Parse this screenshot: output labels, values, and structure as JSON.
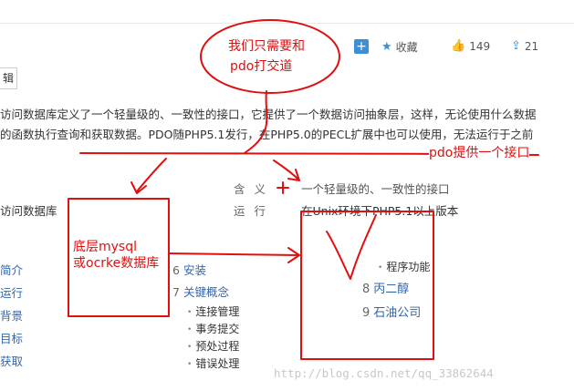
{
  "toolbar": {
    "plus_icon": "+",
    "collect_label": "收藏",
    "like_count": "149",
    "share_count": "21"
  },
  "edit_tag": "辑",
  "paragraph": {
    "line1": "访问数据库定义了一个轻量级的、一致性的接口，它提供了一个数据访问抽象层，这样，无论使用什么数据",
    "line2": "的函数执行查询和获取数据。PDO随PHP5.1发行，在PHP5.0的PECL扩展中也可以使用，无法运行于之前"
  },
  "infobox": {
    "left_term": "访问数据库",
    "label_meaning": "含义",
    "label_run": "运行",
    "value_meaning": "一个轻量级的、一致性的接口",
    "value_run": "在Unix环境下PHP5.1以上版本"
  },
  "toc_left": [
    "简介",
    "运行",
    "背景",
    "目标",
    "获取"
  ],
  "toc_mid": [
    {
      "num": "6",
      "label": "安装"
    },
    {
      "num": "7",
      "label": "关键概念"
    }
  ],
  "toc_mid_sub": [
    "连接管理",
    "事务提交",
    "预处过程",
    "错误处理"
  ],
  "toc_right_sub": "程序功能",
  "toc_right": [
    {
      "num": "8",
      "label": "丙二醇"
    },
    {
      "num": "9",
      "label": "石油公司"
    }
  ],
  "annotations": {
    "bubble": "我们只需要和",
    "bubble2": "pdo打交道",
    "pdo_interface": "pdo提供一个接口",
    "bottom_db": "底层mysql",
    "bottom_db2": "或ocrke数据库"
  },
  "watermark": "http://blog.csdn.net/qq_33862644",
  "colors": {
    "annotation": "#e01010",
    "link": "#3366aa",
    "accent": "#3b8fd6"
  }
}
